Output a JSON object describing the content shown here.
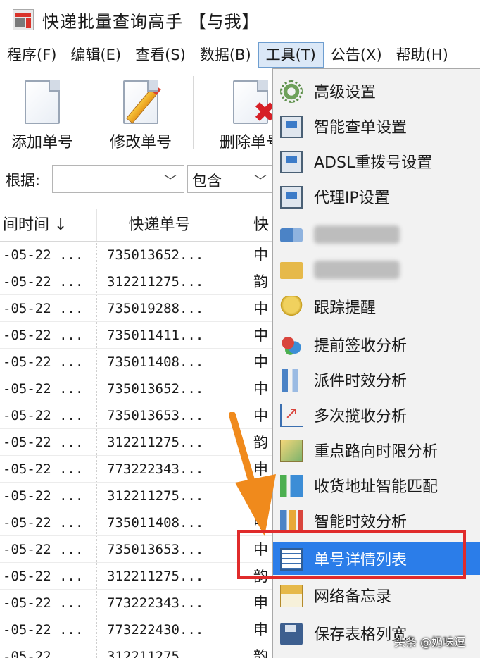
{
  "window": {
    "title": "快递批量查询高手 【与我】"
  },
  "menubar": {
    "items": [
      "程序(F)",
      "编辑(E)",
      "查看(S)",
      "数据(B)",
      "工具(T)",
      "公告(X)",
      "帮助(H)"
    ],
    "active_index": 4
  },
  "toolbar": {
    "add_label": "添加单号",
    "edit_label": "修改单号",
    "delete_label": "删除单号"
  },
  "filter": {
    "label": "根据:",
    "field_value": "",
    "mode_value": "包含"
  },
  "table": {
    "headers": [
      "间时间 ↓",
      "快递单号",
      "快"
    ],
    "rows": [
      [
        "-05-22 ...",
        "735013652...",
        "中"
      ],
      [
        "-05-22 ...",
        "312211275...",
        "韵"
      ],
      [
        "-05-22 ...",
        "735019288...",
        "中"
      ],
      [
        "-05-22 ...",
        "735011411...",
        "中"
      ],
      [
        "-05-22 ...",
        "735011408...",
        "中"
      ],
      [
        "-05-22 ...",
        "735013652...",
        "中"
      ],
      [
        "-05-22 ...",
        "735013653...",
        "中"
      ],
      [
        "-05-22 ...",
        "312211275...",
        "韵"
      ],
      [
        "-05-22 ...",
        "773222343...",
        "申"
      ],
      [
        "-05-22 ...",
        "312211275...",
        "韵"
      ],
      [
        "-05-22 ...",
        "735011408...",
        "中"
      ],
      [
        "-05-22 ...",
        "735013653...",
        "中"
      ],
      [
        "-05-22 ...",
        "312211275...",
        "韵"
      ],
      [
        "-05-22 ...",
        "773222343...",
        "申"
      ],
      [
        "-05-22 ...",
        "773222430...",
        "申"
      ],
      [
        "-05-22 ...",
        "312211275...",
        "韵"
      ]
    ]
  },
  "tools_menu": {
    "items": [
      {
        "label": "高级设置",
        "icon": "gear-icon"
      },
      {
        "label": "智能查单设置",
        "icon": "monitor-icon"
      },
      {
        "label": "ADSL重拨号设置",
        "icon": "monitor-icon"
      },
      {
        "label": "代理IP设置",
        "icon": "monitor-icon"
      },
      {
        "label": "",
        "icon": "truck-icon",
        "blurred": true
      },
      {
        "label": "",
        "icon": "folder-icon",
        "blurred": true
      },
      {
        "label": "跟踪提醒",
        "icon": "bell-icon"
      },
      {
        "label": "提前签收分析",
        "icon": "cubes-icon"
      },
      {
        "label": "派件时效分析",
        "icon": "bar-chart-icon"
      },
      {
        "label": "多次揽收分析",
        "icon": "line-chart-icon"
      },
      {
        "label": "重点路向时限分析",
        "icon": "map-icon"
      },
      {
        "label": "收货地址智能匹配",
        "icon": "match-icon"
      },
      {
        "label": "智能时效分析",
        "icon": "time-chart-icon"
      },
      {
        "label": "单号详情列表",
        "icon": "list-icon",
        "highlighted": true
      },
      {
        "label": "网络备忘录",
        "icon": "notebook-icon"
      },
      {
        "label": "保存表格列宽",
        "icon": "disk-icon"
      }
    ]
  },
  "colors": {
    "highlight": "#2b7de9",
    "annotation_red": "#e02b2b",
    "annotation_arrow": "#f08a1c"
  },
  "watermark": {
    "text": "头条 @奶味逗"
  }
}
